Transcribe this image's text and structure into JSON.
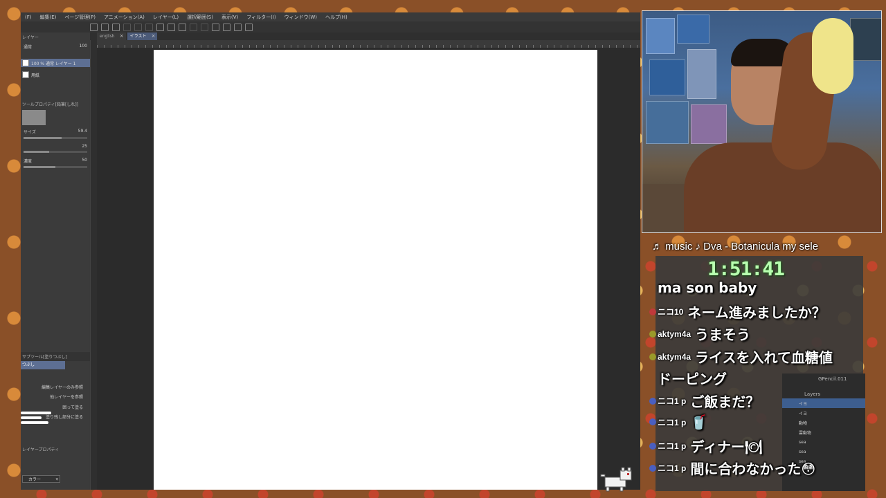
{
  "app": {
    "menu": [
      "(F)",
      "編集(E)",
      "ページ管理(P)",
      "アニメーション(A)",
      "レイヤー(L)",
      "選択範囲(S)",
      "表示(V)",
      "フィルター(I)",
      "ウィンドウ(W)",
      "ヘルプ(H)"
    ],
    "tabs": [
      {
        "label": "english",
        "active": false
      },
      {
        "label": "イラスト",
        "active": true
      }
    ],
    "layer_panel": {
      "title": "レイヤー",
      "blend_mode": "通常",
      "opacity": "100",
      "layers": [
        {
          "label": "100 % 通常 レイヤー 1",
          "selected": true
        },
        {
          "label": "用紙",
          "selected": false
        }
      ]
    },
    "tool_property": {
      "title": "ツールプロパティ[鉛筆[しれ]]",
      "size_label": "サイズ",
      "size_value": "59.4",
      "hardness_value": "25",
      "density_label": "濃度",
      "density_value": "50"
    },
    "subtool": {
      "title": "サブツール[塗りつぶし]",
      "selected": "つぶし",
      "options": [
        "編集レイヤーのみ参照",
        "他レイヤーを参照",
        "囲って塗る",
        "塗り残し部分に塗る"
      ]
    },
    "layer_property": {
      "title": "レイヤープロパティ"
    },
    "color_select": "カラー"
  },
  "overlay": {
    "music": "♬ music ♪ Dva - Botanicula my sele",
    "timer": "1:51:41",
    "chat": [
      {
        "name": "",
        "text": "ma son baby"
      },
      {
        "name": "ニコ10",
        "text": "ネーム進みましたか？"
      },
      {
        "name": "aktym4a",
        "text": "うまそう"
      },
      {
        "name": "aktym4a",
        "text": "ライスを入れて血糖値"
      },
      {
        "name": "",
        "text": "ドーピング"
      },
      {
        "name": "ニコ1 p",
        "text": "ご飯まだ？"
      },
      {
        "name": "ニコ1 p",
        "text": "🥤"
      },
      {
        "name": "ニコ1 p",
        "text": "ディナー🍽"
      },
      {
        "name": "ニコ1 p",
        "text": "間に合わなかった😳"
      }
    ],
    "blender": {
      "object": "GPencil.011",
      "layers_label": "Layers",
      "layers": [
        "イヨ",
        "イヨ",
        "動物",
        "雲動物",
        "sea",
        "sea",
        "sea"
      ]
    }
  }
}
